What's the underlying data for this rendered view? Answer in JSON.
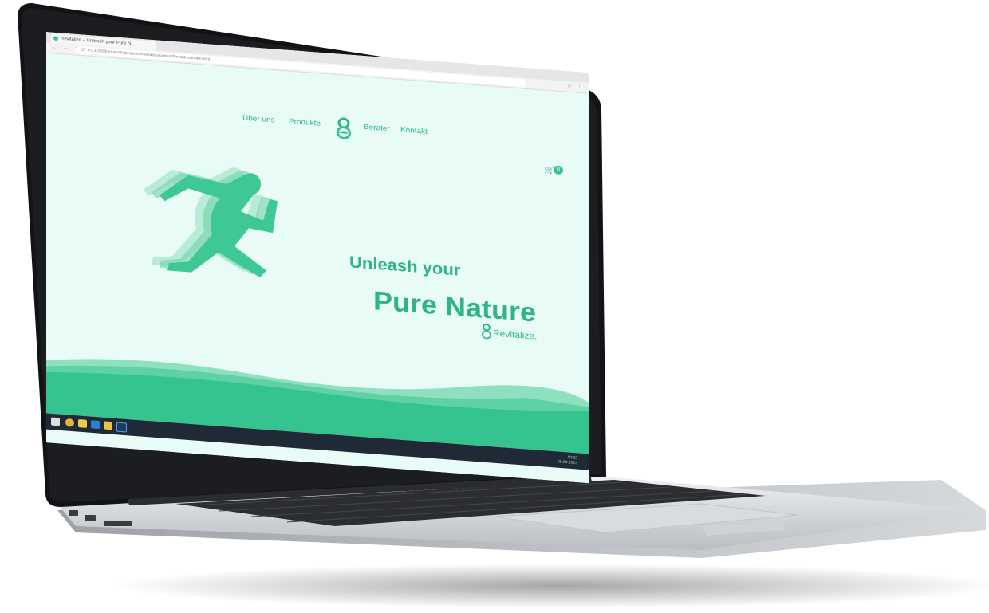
{
  "browser": {
    "tab_title": "Revitalize – Unleash your Pure N...",
    "nav_glyphs": "← → ⟳",
    "url": "127.0.0.1:5500/src/public/projects/Revitalize/content/Revitalize/index.html",
    "toolbar_glyphs": "☆ ⋮"
  },
  "nav": {
    "items": [
      "Über uns",
      "Produkte",
      "Berater",
      "Kontakt"
    ]
  },
  "cart": {
    "icon": "shopping-cart-icon",
    "glyph": "🛒",
    "count": "0"
  },
  "hero": {
    "line1": "Unleash your",
    "line2": "Pure Nature",
    "brand": "Revitalize."
  },
  "taskbar": {
    "time": "10:22",
    "date": "06.09.2023"
  },
  "colors": {
    "accent": "#2fb487",
    "page_bg": "#e9fbf6",
    "wave": "#35c48f"
  }
}
